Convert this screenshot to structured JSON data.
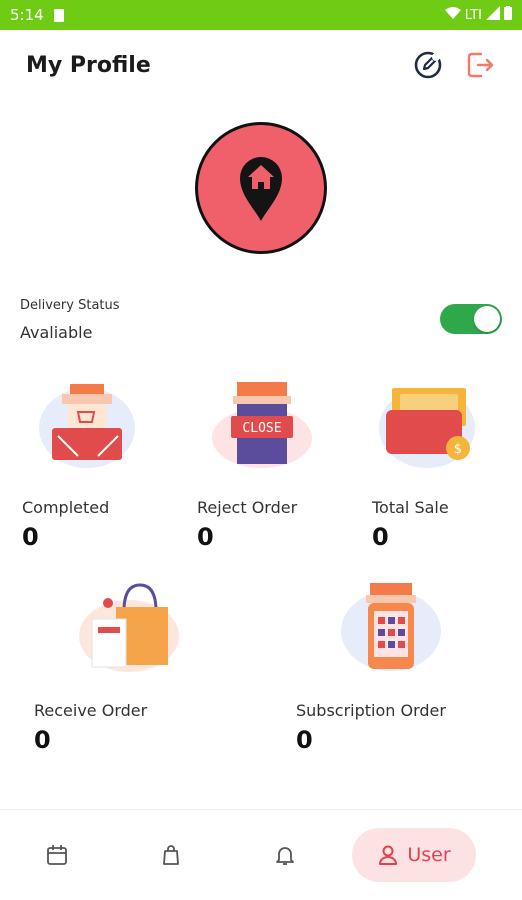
{
  "status_bar": {
    "time": "5:14",
    "network": "LTI"
  },
  "header": {
    "title": "My Profile",
    "edit_icon": "edit-icon",
    "logout_icon": "logout-icon"
  },
  "profile": {
    "avatar_icon": "home-pin-icon"
  },
  "delivery": {
    "label": "Delivery Status",
    "value": "Avaliable",
    "enabled": true
  },
  "stats": {
    "completed": {
      "label": "Completed",
      "value": "0"
    },
    "reject": {
      "label": "Reject Order",
      "value": "0"
    },
    "total_sale": {
      "label": "Total Sale",
      "value": "0"
    },
    "receive": {
      "label": "Receive Order",
      "value": "0"
    },
    "subscription": {
      "label": "Subscription Order",
      "value": "0"
    }
  },
  "nav": {
    "items": [
      {
        "icon": "calendar-icon"
      },
      {
        "icon": "bag-icon"
      },
      {
        "icon": "bell-icon"
      },
      {
        "icon": "user-icon",
        "label": "User",
        "active": true
      }
    ]
  },
  "colors": {
    "status_green": "#6fcb14",
    "accent_red": "#e4404f",
    "avatar_bg": "#f0606b",
    "toggle_green": "#2fa84c"
  }
}
